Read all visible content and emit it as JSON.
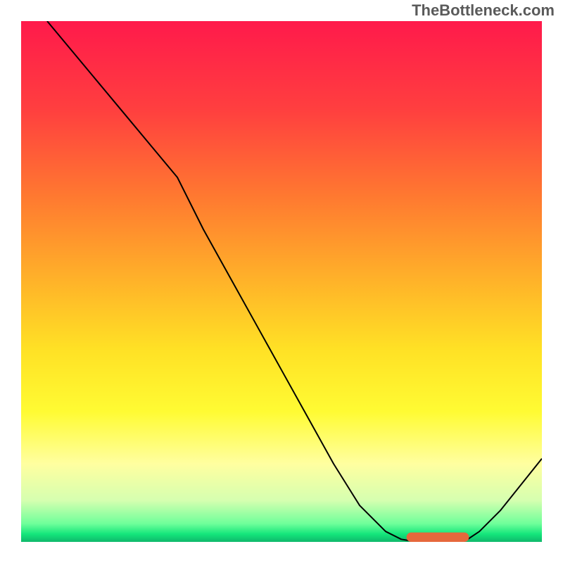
{
  "attribution": "TheBottleneck.com",
  "chart_data": {
    "type": "line",
    "title": "",
    "xlabel": "",
    "ylabel": "",
    "xlim": [
      0,
      100
    ],
    "ylim": [
      0,
      100
    ],
    "background_gradient_stops": [
      {
        "offset": 0.0,
        "color": "#ff1a4b"
      },
      {
        "offset": 0.17,
        "color": "#ff3f3f"
      },
      {
        "offset": 0.34,
        "color": "#ff7a30"
      },
      {
        "offset": 0.5,
        "color": "#ffb329"
      },
      {
        "offset": 0.63,
        "color": "#ffe125"
      },
      {
        "offset": 0.75,
        "color": "#fffb33"
      },
      {
        "offset": 0.85,
        "color": "#ffffa0"
      },
      {
        "offset": 0.92,
        "color": "#d6ffb0"
      },
      {
        "offset": 0.965,
        "color": "#6fff9a"
      },
      {
        "offset": 0.985,
        "color": "#14e67b"
      },
      {
        "offset": 1.0,
        "color": "#0fb86b"
      }
    ],
    "series": [
      {
        "name": "curve",
        "color": "#000000",
        "width": 2,
        "x": [
          5,
          10,
          15,
          20,
          25,
          30,
          35,
          40,
          45,
          50,
          55,
          60,
          65,
          70,
          73,
          76,
          79,
          82,
          85,
          88,
          92,
          96,
          100
        ],
        "y": [
          100,
          94,
          88,
          82,
          76,
          70,
          60,
          51,
          42,
          33,
          24,
          15,
          7,
          2,
          0.5,
          0,
          0,
          0,
          0,
          2,
          6,
          11,
          16
        ]
      },
      {
        "name": "highlight-bar",
        "type": "bar-segment",
        "color": "#e6683c",
        "y": 0,
        "x0": 74,
        "x1": 86,
        "height": 1.8,
        "rounded": true
      }
    ]
  }
}
